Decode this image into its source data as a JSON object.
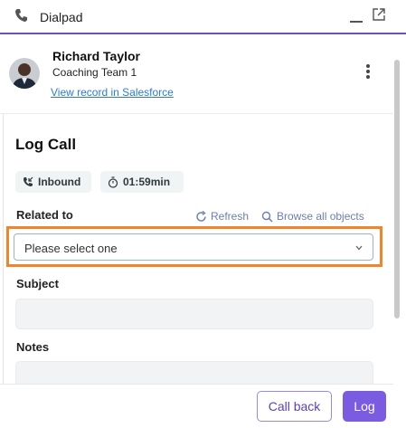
{
  "window": {
    "title": "Dialpad",
    "icons": {
      "app": "phone-icon",
      "minimize": "minimize-icon",
      "popout": "popout-icon"
    }
  },
  "contact": {
    "name": "Richard Taylor",
    "team": "Coaching Team 1",
    "link": "View record in Salesforce",
    "avatar": "avatar-photo",
    "menu_icon": "more-vertical-icon"
  },
  "log_call": {
    "title": "Log Call",
    "direction": "Inbound",
    "duration": "01:59min",
    "related_label": "Related to",
    "refresh_label": "Refresh",
    "browse_label": "Browse all objects",
    "related_placeholder": "Please select one",
    "subject_label": "Subject",
    "subject_value": "",
    "notes_label": "Notes",
    "notes_value": ""
  },
  "footer": {
    "call_back": "Call back",
    "log": "Log"
  },
  "colors": {
    "accent": "#7b5ce0",
    "link": "#2b7bd9",
    "highlight": "#f0862a",
    "chip_bg": "#f1f4f5"
  }
}
